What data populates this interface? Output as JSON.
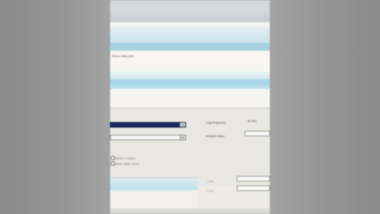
{
  "panel1": {
    "text": "Show utility part"
  },
  "form": {
    "combo1_arrow": "▾",
    "combo2_arrow": "▾",
    "label_right1": "Log frequency",
    "label_right1_value": "M   Yes",
    "label_right2": "Default Value",
    "hint1": "Check Contact",
    "hint2": "Show other items"
  },
  "bottom": {
    "label1": "Line",
    "label2": "Line"
  },
  "status": {
    "text": ""
  }
}
